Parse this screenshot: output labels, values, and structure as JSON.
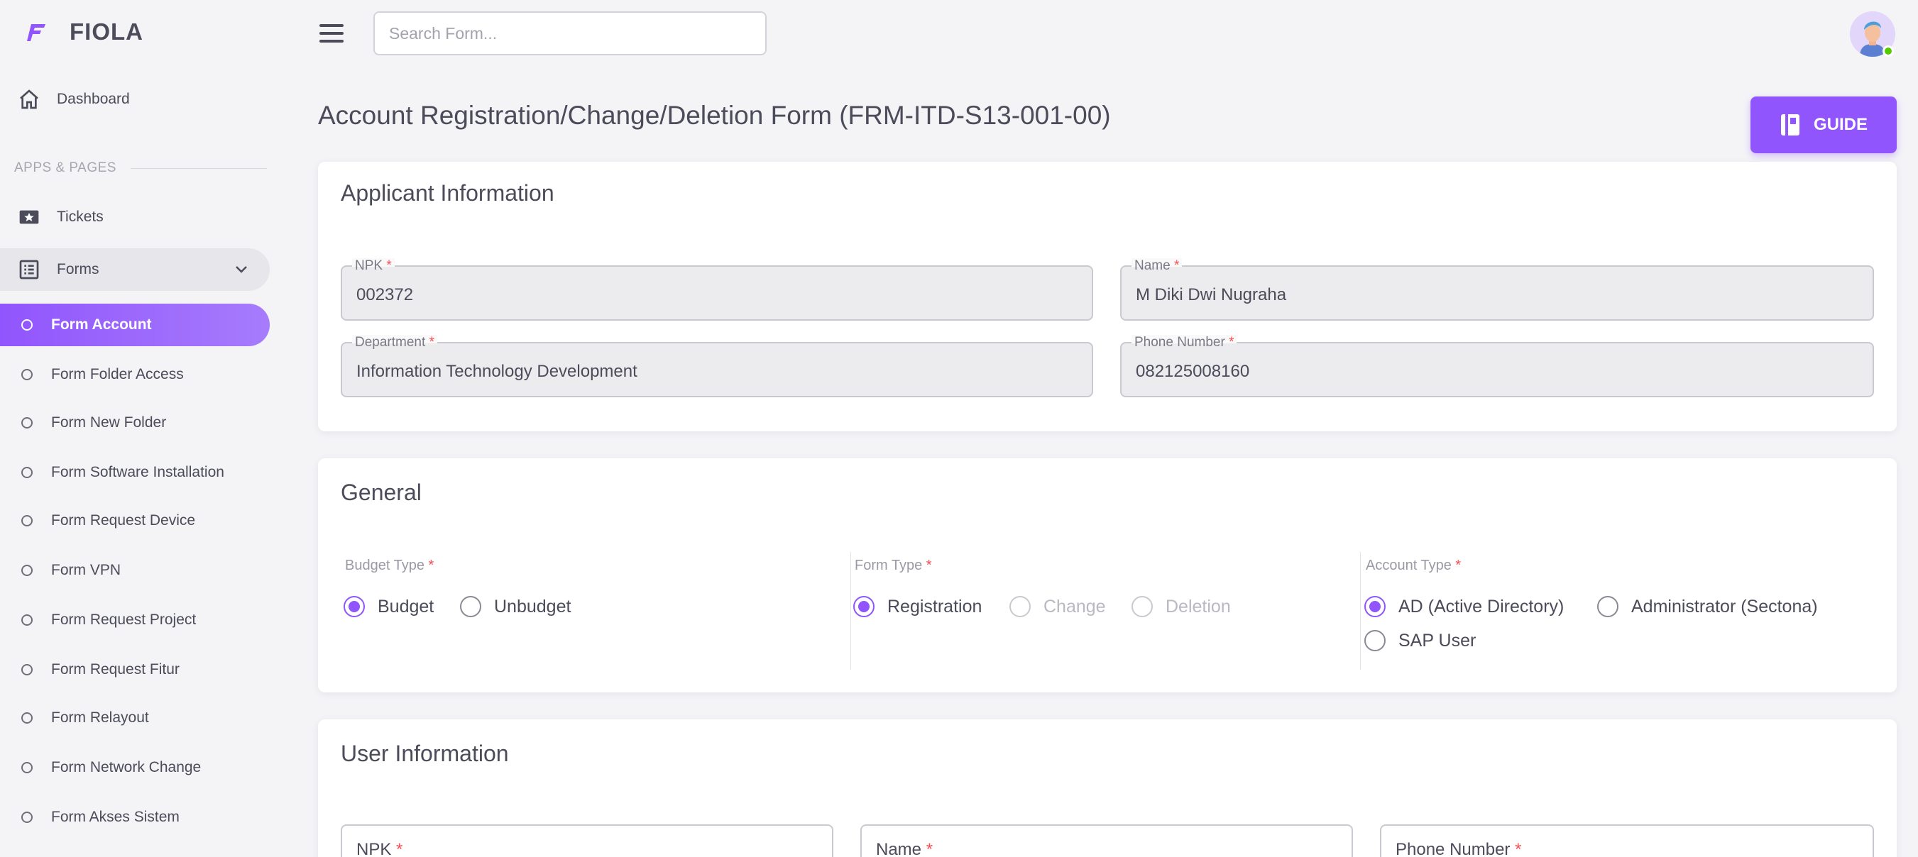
{
  "app": {
    "name": "FIOLA"
  },
  "topbar": {
    "search_placeholder": "Search Form..."
  },
  "sidebar": {
    "dashboard_label": "Dashboard",
    "section_title": "APPS & PAGES",
    "tickets_label": "Tickets",
    "forms_label": "Forms",
    "sub_items": [
      "Form Account",
      "Form Folder Access",
      "Form New Folder",
      "Form Software Installation",
      "Form Request Device",
      "Form VPN",
      "Form Request Project",
      "Form Request Fitur",
      "Form Relayout",
      "Form Network Change",
      "Form Akses Sistem"
    ]
  },
  "page": {
    "title": "Account Registration/Change/Deletion Form (FRM-ITD-S13-001-00)",
    "guide_label": "GUIDE"
  },
  "applicant": {
    "title": "Applicant Information",
    "npk_label": "NPK",
    "npk_value": "002372",
    "name_label": "Name",
    "name_value": "M Diki Dwi Nugraha",
    "department_label": "Department",
    "department_value": "Information Technology Development",
    "phone_label": "Phone Number",
    "phone_value": "082125008160",
    "required_mark": "*"
  },
  "general": {
    "title": "General",
    "budget_type_label": "Budget Type",
    "budget_options": [
      "Budget",
      "Unbudget"
    ],
    "form_type_label": "Form Type",
    "form_type_options": [
      "Registration",
      "Change",
      "Deletion"
    ],
    "account_type_label": "Account Type",
    "account_type_options": [
      "AD (Active Directory)",
      "Administrator (Sectona)",
      "SAP User"
    ]
  },
  "user_info": {
    "title": "User Information",
    "npk_label": "NPK",
    "name_label": "Name",
    "phone_label": "Phone Number"
  },
  "colors": {
    "primary": "#9155fd",
    "required": "#ff4c51",
    "online": "#56ca00"
  }
}
